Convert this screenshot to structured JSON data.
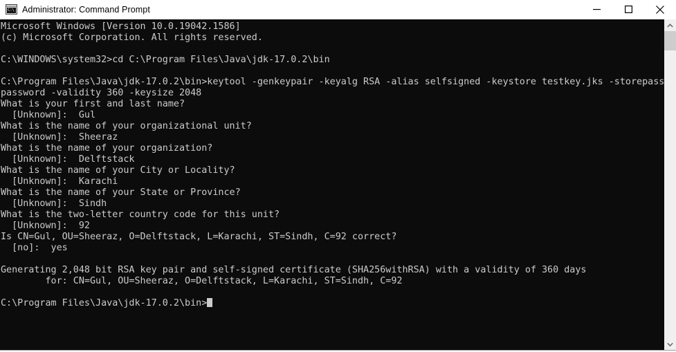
{
  "window": {
    "title": "Administrator: Command Prompt",
    "icon": "command-prompt-icon",
    "icon_glyph": "C:\\",
    "background_color": "#0c0c0c",
    "text_color": "#cccccc",
    "titlebar_color": "#ffffff"
  },
  "controls": {
    "minimize": "minimize-button",
    "maximize": "maximize-button",
    "close": "close-button"
  },
  "scrollbar": {
    "up_arrow": "scroll-up-arrow",
    "down_arrow": "scroll-down-arrow",
    "thumb": "scrollbar-thumb"
  },
  "console": {
    "text": "Microsoft Windows [Version 10.0.19042.1586]\n(c) Microsoft Corporation. All rights reserved.\n\nC:\\WINDOWS\\system32>cd C:\\Program Files\\Java\\jdk-17.0.2\\bin\n\nC:\\Program Files\\Java\\jdk-17.0.2\\bin>keytool -genkeypair -keyalg RSA -alias selfsigned -keystore testkey.jks -storepass\npassword -validity 360 -keysize 2048\nWhat is your first and last name?\n  [Unknown]:  Gul\nWhat is the name of your organizational unit?\n  [Unknown]:  Sheeraz\nWhat is the name of your organization?\n  [Unknown]:  Delftstack\nWhat is the name of your City or Locality?\n  [Unknown]:  Karachi\nWhat is the name of your State or Province?\n  [Unknown]:  Sindh\nWhat is the two-letter country code for this unit?\n  [Unknown]:  92\nIs CN=Gul, OU=Sheeraz, O=Delftstack, L=Karachi, ST=Sindh, C=92 correct?\n  [no]:  yes\n\nGenerating 2,048 bit RSA key pair and self-signed certificate (SHA256withRSA) with a validity of 360 days\n        for: CN=Gul, OU=Sheeraz, O=Delftstack, L=Karachi, ST=Sindh, C=92\n\nC:\\Program Files\\Java\\jdk-17.0.2\\bin>",
    "lines": [
      "Microsoft Windows [Version 10.0.19042.1586]",
      "(c) Microsoft Corporation. All rights reserved.",
      "",
      "C:\\WINDOWS\\system32>cd C:\\Program Files\\Java\\jdk-17.0.2\\bin",
      "",
      "C:\\Program Files\\Java\\jdk-17.0.2\\bin>keytool -genkeypair -keyalg RSA -alias selfsigned -keystore testkey.jks -storepass",
      "password -validity 360 -keysize 2048",
      "What is your first and last name?",
      "  [Unknown]:  Gul",
      "What is the name of your organizational unit?",
      "  [Unknown]:  Sheeraz",
      "What is the name of your organization?",
      "  [Unknown]:  Delftstack",
      "What is the name of your City or Locality?",
      "  [Unknown]:  Karachi",
      "What is the name of your State or Province?",
      "  [Unknown]:  Sindh",
      "What is the two-letter country code for this unit?",
      "  [Unknown]:  92",
      "Is CN=Gul, OU=Sheeraz, O=Delftstack, L=Karachi, ST=Sindh, C=92 correct?",
      "  [no]:  yes",
      "",
      "Generating 2,048 bit RSA key pair and self-signed certificate (SHA256withRSA) with a validity of 360 days",
      "        for: CN=Gul, OU=Sheeraz, O=Delftstack, L=Karachi, ST=Sindh, C=92",
      "",
      "C:\\Program Files\\Java\\jdk-17.0.2\\bin>"
    ],
    "prompt": "C:\\Program Files\\Java\\jdk-17.0.2\\bin>",
    "cursor": "block-cursor"
  }
}
